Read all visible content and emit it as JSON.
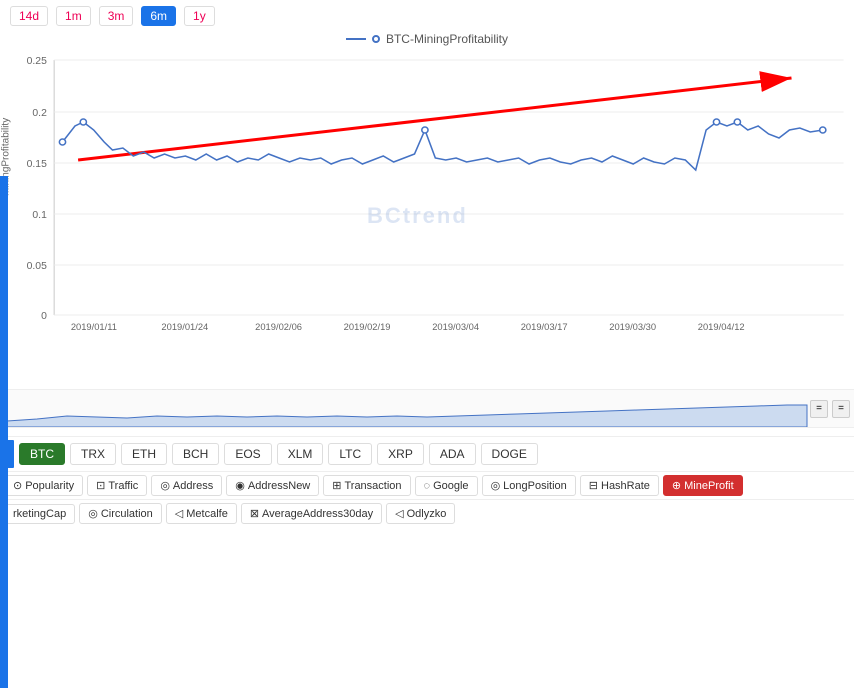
{
  "header": {
    "time_buttons": [
      {
        "label": "14d",
        "active": false
      },
      {
        "label": "1m",
        "active": false
      },
      {
        "label": "3m",
        "active": false
      },
      {
        "label": "6m",
        "active": true
      },
      {
        "label": "1y",
        "active": false
      }
    ]
  },
  "chart": {
    "legend_label": "BTC-MiningProfitability",
    "watermark": "BCtrend",
    "y_axis_label": "MiningProfitability",
    "y_ticks": [
      "0.25",
      "0.2",
      "0.15",
      "0.1",
      "0.05",
      "0"
    ],
    "x_ticks": [
      "2019/01/11",
      "2019/01/24",
      "2019/02/06",
      "2019/02/19",
      "2019/03/04",
      "2019/03/17",
      "2019/03/30",
      "2019/04/12"
    ]
  },
  "coins": [
    {
      "label": "BTC",
      "active": true
    },
    {
      "label": "TRX",
      "active": false
    },
    {
      "label": "ETH",
      "active": false
    },
    {
      "label": "BCH",
      "active": false
    },
    {
      "label": "EOS",
      "active": false
    },
    {
      "label": "XLM",
      "active": false
    },
    {
      "label": "LTC",
      "active": false
    },
    {
      "label": "XRP",
      "active": false
    },
    {
      "label": "ADA",
      "active": false
    },
    {
      "label": "DOGE",
      "active": false
    }
  ],
  "metrics_row1": [
    {
      "label": "Popularity",
      "icon": "⊙",
      "active": false
    },
    {
      "label": "Traffic",
      "icon": "⊡",
      "active": false
    },
    {
      "label": "Address",
      "icon": "◎",
      "active": false
    },
    {
      "label": "AddressNew",
      "icon": "◉",
      "active": false
    },
    {
      "label": "Transaction",
      "icon": "⊞",
      "active": false
    },
    {
      "label": "Google",
      "icon": "◌",
      "active": false
    },
    {
      "label": "LongPosition",
      "icon": "◎",
      "active": false
    },
    {
      "label": "HashRate",
      "icon": "⊟",
      "active": false
    },
    {
      "label": "MineProfit",
      "icon": "⊕",
      "active": true
    }
  ],
  "metrics_row2": [
    {
      "label": "rketingCap",
      "icon": "",
      "active": false
    },
    {
      "label": "Circulation",
      "icon": "◎",
      "active": false
    },
    {
      "label": "Metcalfe",
      "icon": "◁",
      "active": false
    },
    {
      "label": "AverageAddress30day",
      "icon": "⊠",
      "active": false
    },
    {
      "label": "Odlyzko",
      "icon": "◁",
      "active": false
    }
  ]
}
